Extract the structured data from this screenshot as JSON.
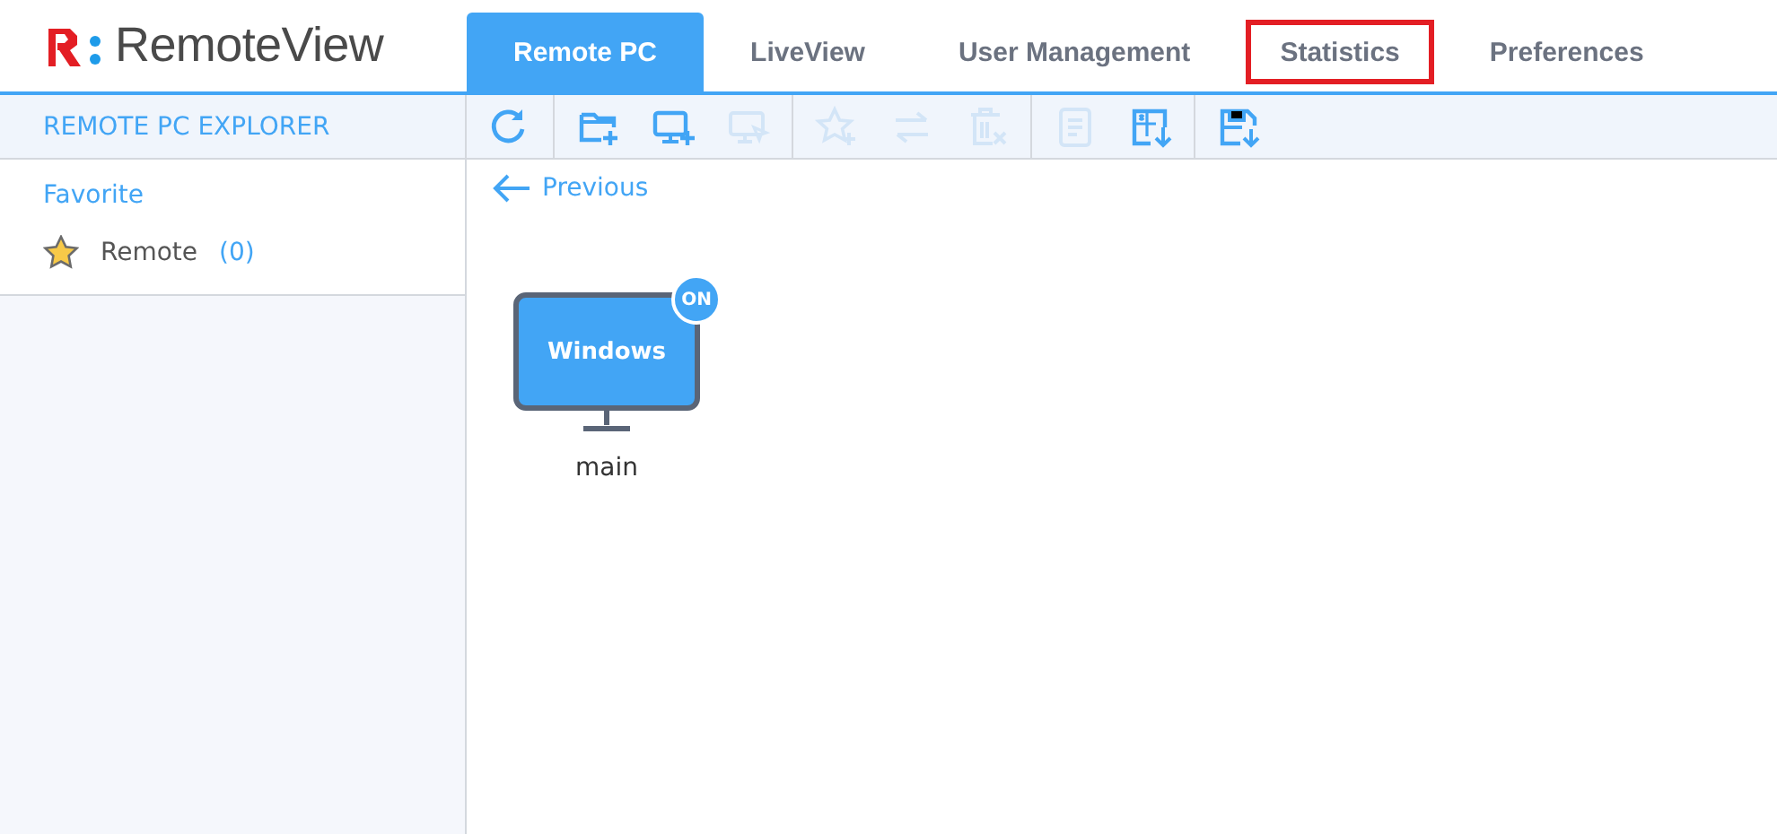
{
  "logo": {
    "text": "RemoteView"
  },
  "tabs": [
    {
      "label": "Remote PC",
      "selected": true,
      "highlighted": false
    },
    {
      "label": "LiveView",
      "selected": false,
      "highlighted": false
    },
    {
      "label": "User Management",
      "selected": false,
      "highlighted": false
    },
    {
      "label": "Statistics",
      "selected": false,
      "highlighted": true
    },
    {
      "label": "Preferences",
      "selected": false,
      "highlighted": false
    }
  ],
  "sidebar": {
    "title": "REMOTE PC EXPLORER",
    "section": "Favorite",
    "items": [
      {
        "label": "Remote",
        "count": "(0)"
      }
    ]
  },
  "toolbar": [
    [
      {
        "kind": "refresh",
        "disabled": false
      }
    ],
    [
      {
        "kind": "folder-add",
        "disabled": false
      },
      {
        "kind": "monitor-add",
        "disabled": false
      },
      {
        "kind": "monitor-select",
        "disabled": true
      }
    ],
    [
      {
        "kind": "star-add",
        "disabled": true
      },
      {
        "kind": "swap",
        "disabled": true
      },
      {
        "kind": "delete",
        "disabled": true
      }
    ],
    [
      {
        "kind": "note",
        "disabled": true
      },
      {
        "kind": "export",
        "disabled": false
      }
    ],
    [
      {
        "kind": "save",
        "disabled": false
      }
    ]
  ],
  "back": {
    "label": "Previous"
  },
  "devices": [
    {
      "name": "main",
      "os": "Windows",
      "status": "ON",
      "online": true
    }
  ]
}
